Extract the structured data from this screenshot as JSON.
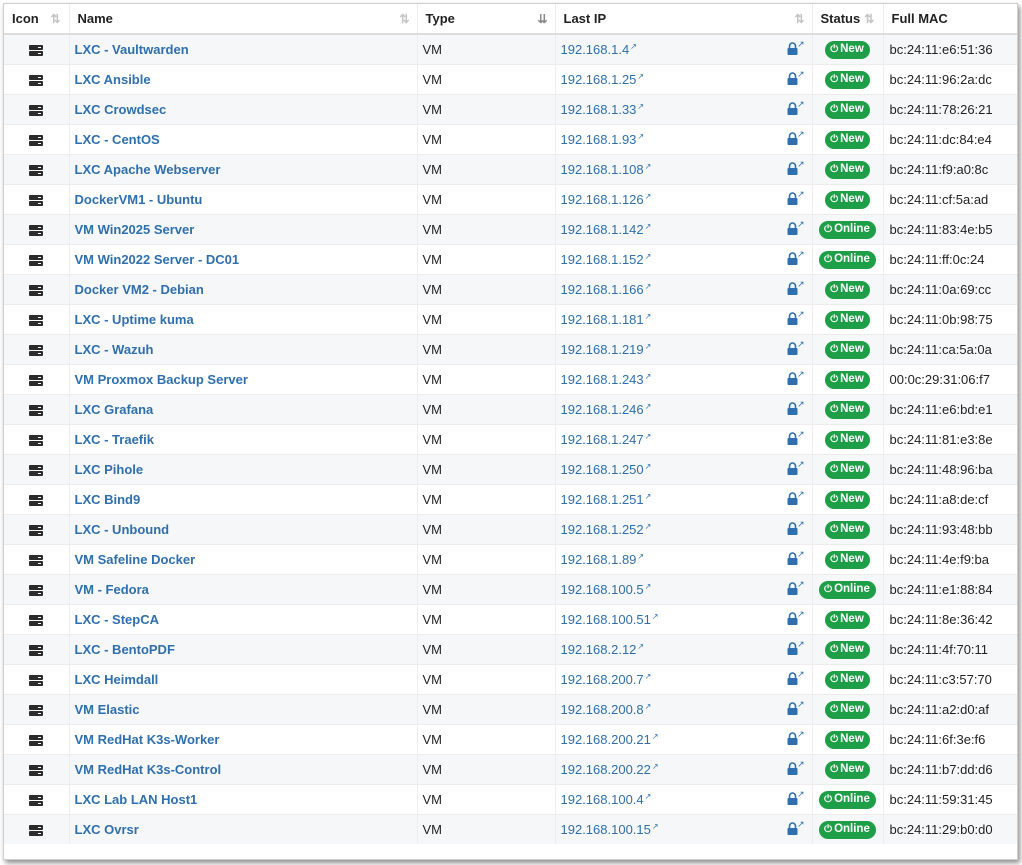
{
  "headers": {
    "icon": "Icon",
    "name": "Name",
    "type": "Type",
    "last_ip": "Last IP",
    "status": "Status",
    "mac": "Full MAC"
  },
  "colors": {
    "link": "#2f6fad",
    "badge": "#1e9e47"
  },
  "rows": [
    {
      "name": "LXC - Vaultwarden",
      "type": "VM",
      "ip": "192.168.1.4",
      "status": "New",
      "mac": "bc:24:11:e6:51:36"
    },
    {
      "name": "LXC Ansible",
      "type": "VM",
      "ip": "192.168.1.25",
      "status": "New",
      "mac": "bc:24:11:96:2a:dc"
    },
    {
      "name": "LXC Crowdsec",
      "type": "VM",
      "ip": "192.168.1.33",
      "status": "New",
      "mac": "bc:24:11:78:26:21"
    },
    {
      "name": "LXC - CentOS",
      "type": "VM",
      "ip": "192.168.1.93",
      "status": "New",
      "mac": "bc:24:11:dc:84:e4"
    },
    {
      "name": "LXC Apache Webserver",
      "type": "VM",
      "ip": "192.168.1.108",
      "status": "New",
      "mac": "bc:24:11:f9:a0:8c"
    },
    {
      "name": "DockerVM1 - Ubuntu",
      "type": "VM",
      "ip": "192.168.1.126",
      "status": "New",
      "mac": "bc:24:11:cf:5a:ad"
    },
    {
      "name": "VM Win2025 Server",
      "type": "VM",
      "ip": "192.168.1.142",
      "status": "Online",
      "mac": "bc:24:11:83:4e:b5"
    },
    {
      "name": "VM Win2022 Server - DC01",
      "type": "VM",
      "ip": "192.168.1.152",
      "status": "Online",
      "mac": "bc:24:11:ff:0c:24"
    },
    {
      "name": "Docker VM2 - Debian",
      "type": "VM",
      "ip": "192.168.1.166",
      "status": "New",
      "mac": "bc:24:11:0a:69:cc"
    },
    {
      "name": "LXC - Uptime kuma",
      "type": "VM",
      "ip": "192.168.1.181",
      "status": "New",
      "mac": "bc:24:11:0b:98:75"
    },
    {
      "name": "LXC - Wazuh",
      "type": "VM",
      "ip": "192.168.1.219",
      "status": "New",
      "mac": "bc:24:11:ca:5a:0a"
    },
    {
      "name": "VM Proxmox Backup Server",
      "type": "VM",
      "ip": "192.168.1.243",
      "status": "New",
      "mac": "00:0c:29:31:06:f7"
    },
    {
      "name": "LXC Grafana",
      "type": "VM",
      "ip": "192.168.1.246",
      "status": "New",
      "mac": "bc:24:11:e6:bd:e1"
    },
    {
      "name": "LXC - Traefik",
      "type": "VM",
      "ip": "192.168.1.247",
      "status": "New",
      "mac": "bc:24:11:81:e3:8e"
    },
    {
      "name": "LXC Pihole",
      "type": "VM",
      "ip": "192.168.1.250",
      "status": "New",
      "mac": "bc:24:11:48:96:ba"
    },
    {
      "name": "LXC Bind9",
      "type": "VM",
      "ip": "192.168.1.251",
      "status": "New",
      "mac": "bc:24:11:a8:de:cf"
    },
    {
      "name": "LXC - Unbound",
      "type": "VM",
      "ip": "192.168.1.252",
      "status": "New",
      "mac": "bc:24:11:93:48:bb"
    },
    {
      "name": "VM Safeline Docker",
      "type": "VM",
      "ip": "192.168.1.89",
      "status": "New",
      "mac": "bc:24:11:4e:f9:ba"
    },
    {
      "name": "VM - Fedora",
      "type": "VM",
      "ip": "192.168.100.5",
      "status": "Online",
      "mac": "bc:24:11:e1:88:84"
    },
    {
      "name": "LXC - StepCA",
      "type": "VM",
      "ip": "192.168.100.51",
      "status": "New",
      "mac": "bc:24:11:8e:36:42"
    },
    {
      "name": "LXC - BentoPDF",
      "type": "VM",
      "ip": "192.168.2.12",
      "status": "New",
      "mac": "bc:24:11:4f:70:11"
    },
    {
      "name": "LXC Heimdall",
      "type": "VM",
      "ip": "192.168.200.7",
      "status": "New",
      "mac": "bc:24:11:c3:57:70"
    },
    {
      "name": "VM Elastic",
      "type": "VM",
      "ip": "192.168.200.8",
      "status": "New",
      "mac": "bc:24:11:a2:d0:af"
    },
    {
      "name": "VM RedHat K3s-Worker",
      "type": "VM",
      "ip": "192.168.200.21",
      "status": "New",
      "mac": "bc:24:11:6f:3e:f6"
    },
    {
      "name": "VM RedHat K3s-Control",
      "type": "VM",
      "ip": "192.168.200.22",
      "status": "New",
      "mac": "bc:24:11:b7:dd:d6"
    },
    {
      "name": "LXC Lab LAN Host1",
      "type": "VM",
      "ip": "192.168.100.4",
      "status": "Online",
      "mac": "bc:24:11:59:31:45"
    },
    {
      "name": "LXC Ovrsr",
      "type": "VM",
      "ip": "192.168.100.15",
      "status": "Online",
      "mac": "bc:24:11:29:b0:d0"
    }
  ]
}
